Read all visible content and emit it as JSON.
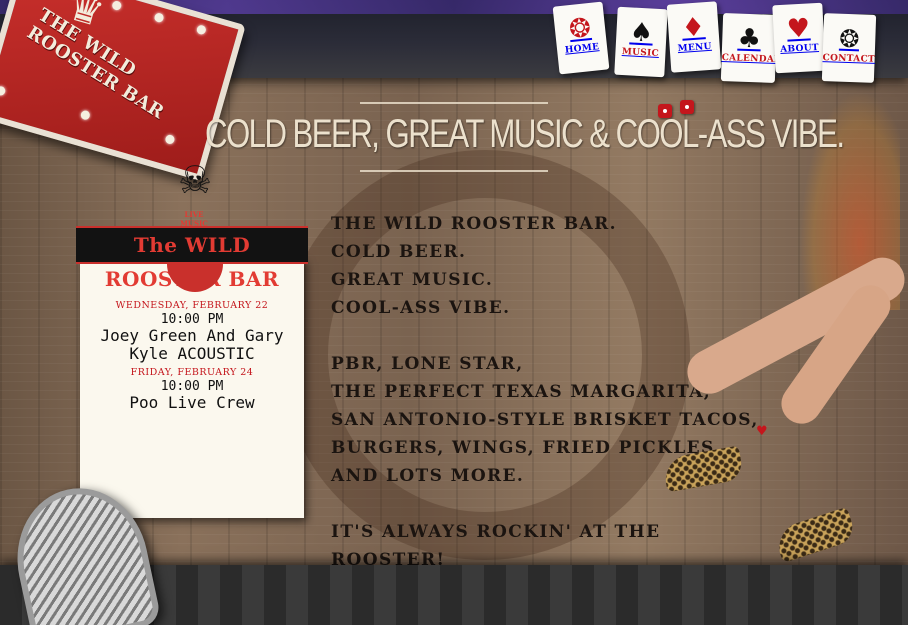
{
  "brand": {
    "logo_text": "THE WILD ROOSTER BAR"
  },
  "nav": [
    {
      "label": "HOME",
      "icon": "rooster-icon",
      "color": "#111111"
    },
    {
      "label": "MUSIC",
      "icon": "spade-icon",
      "color": "#c4161c"
    },
    {
      "label": "MENU",
      "icon": "diamond-icon",
      "color": "#111111"
    },
    {
      "label": "CALENDAR",
      "icon": "club-icon",
      "color": "#c4161c"
    },
    {
      "label": "ABOUT",
      "icon": "heart-icon",
      "color": "#111111"
    },
    {
      "label": "CONTACT",
      "icon": "rooster-icon",
      "color": "#c4161c"
    }
  ],
  "headline": {
    "text": "COLD BEER, GREAT MUSIC & COOL-ASS VIBE."
  },
  "panel": {
    "badge_text": "LIVE MUSIC",
    "title": "The WILD ROOSTER BAR",
    "events": [
      {
        "date": "WEDNESDAY, FEBRUARY 22",
        "time": "10:00 PM",
        "title": "Joey Green And Gary Kyle ACOUSTIC"
      },
      {
        "date": "FRIDAY, FEBRUARY 24",
        "time": "10:00 PM",
        "title": "Poo Live Crew"
      }
    ]
  },
  "main_text": {
    "lines_a": [
      "THE WILD ROOSTER BAR.",
      "COLD BEER.",
      "GREAT MUSIC.",
      "COOL-ASS VIBE."
    ],
    "lines_b": [
      "PBR, LONE STAR,",
      "THE PERFECT TEXAS MARGARITA,",
      "SAN ANTONIO-STYLE BRISKET TACOS,",
      "BURGERS, WINGS, FRIED PICKLES,",
      "AND LOTS MORE."
    ],
    "closing": "IT'S ALWAYS ROCKIN' AT THE ROOSTER!"
  },
  "colors": {
    "accent_red": "#c4161c",
    "wood": "#7a6350",
    "text_dark": "#1b1410"
  }
}
